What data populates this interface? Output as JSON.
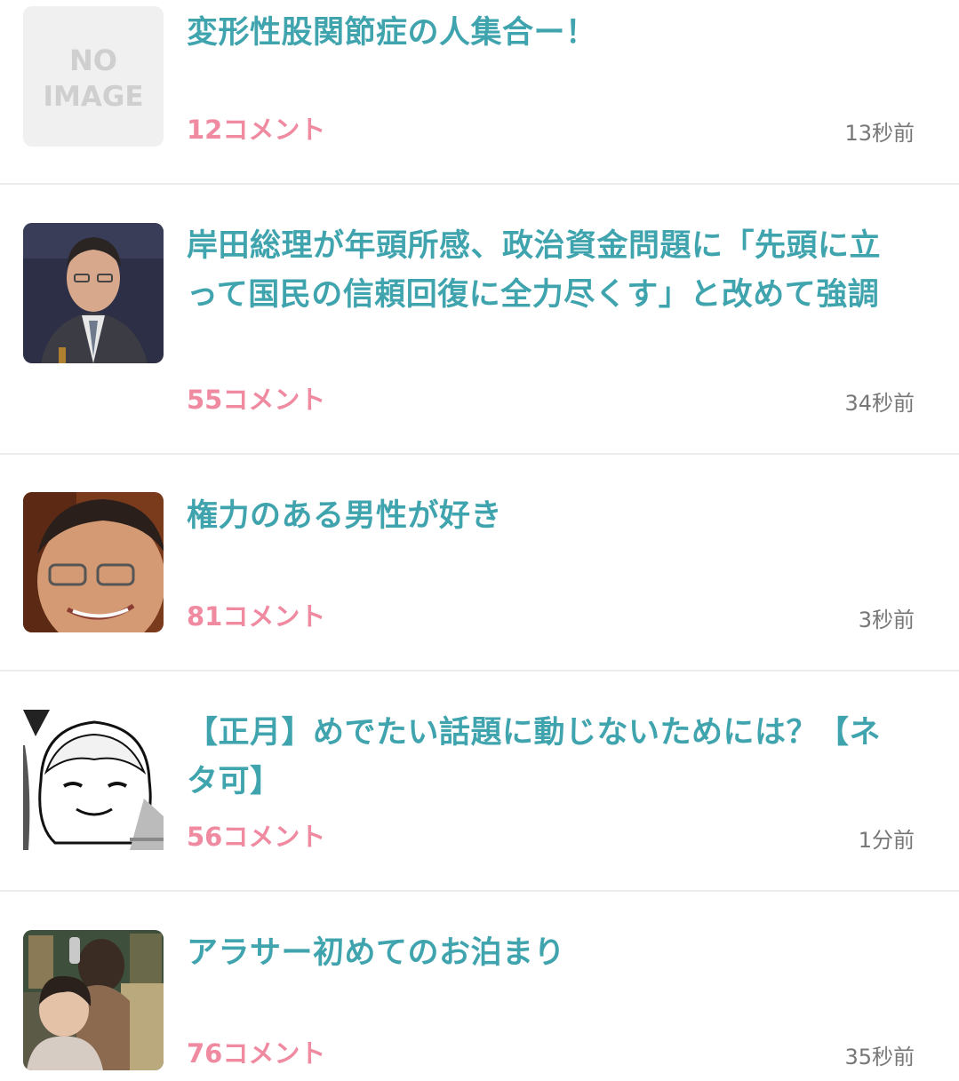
{
  "colors": {
    "title": "#3fa4ad",
    "comments": "#ef8aa1",
    "time": "#777777",
    "divider": "#ededed"
  },
  "no_image_label": [
    "NO",
    "IMAGE"
  ],
  "topics": [
    {
      "title": "変形性股関節症の人集合ー！",
      "comments": "12コメント",
      "time": "13秒前",
      "thumb": "no-image"
    },
    {
      "title": "岸田総理が年頭所感、政治資金問題に「先頭に立って国民の信頼回復に全力尽くす」と改めて強調",
      "comments": "55コメント",
      "time": "34秒前",
      "thumb": "man-in-suit-photo"
    },
    {
      "title": "権力のある男性が好き",
      "comments": "81コメント",
      "time": "3秒前",
      "thumb": "smiling-man-closeup-photo"
    },
    {
      "title": "【正月】めでたい話題に動じないためには？【ネタ可】",
      "comments": "56コメント",
      "time": "1分前",
      "thumb": "manga-girl-illustration"
    },
    {
      "title": "アラサー初めてのお泊まり",
      "comments": "76コメント",
      "time": "35秒前",
      "thumb": "two-people-room-photo"
    }
  ]
}
